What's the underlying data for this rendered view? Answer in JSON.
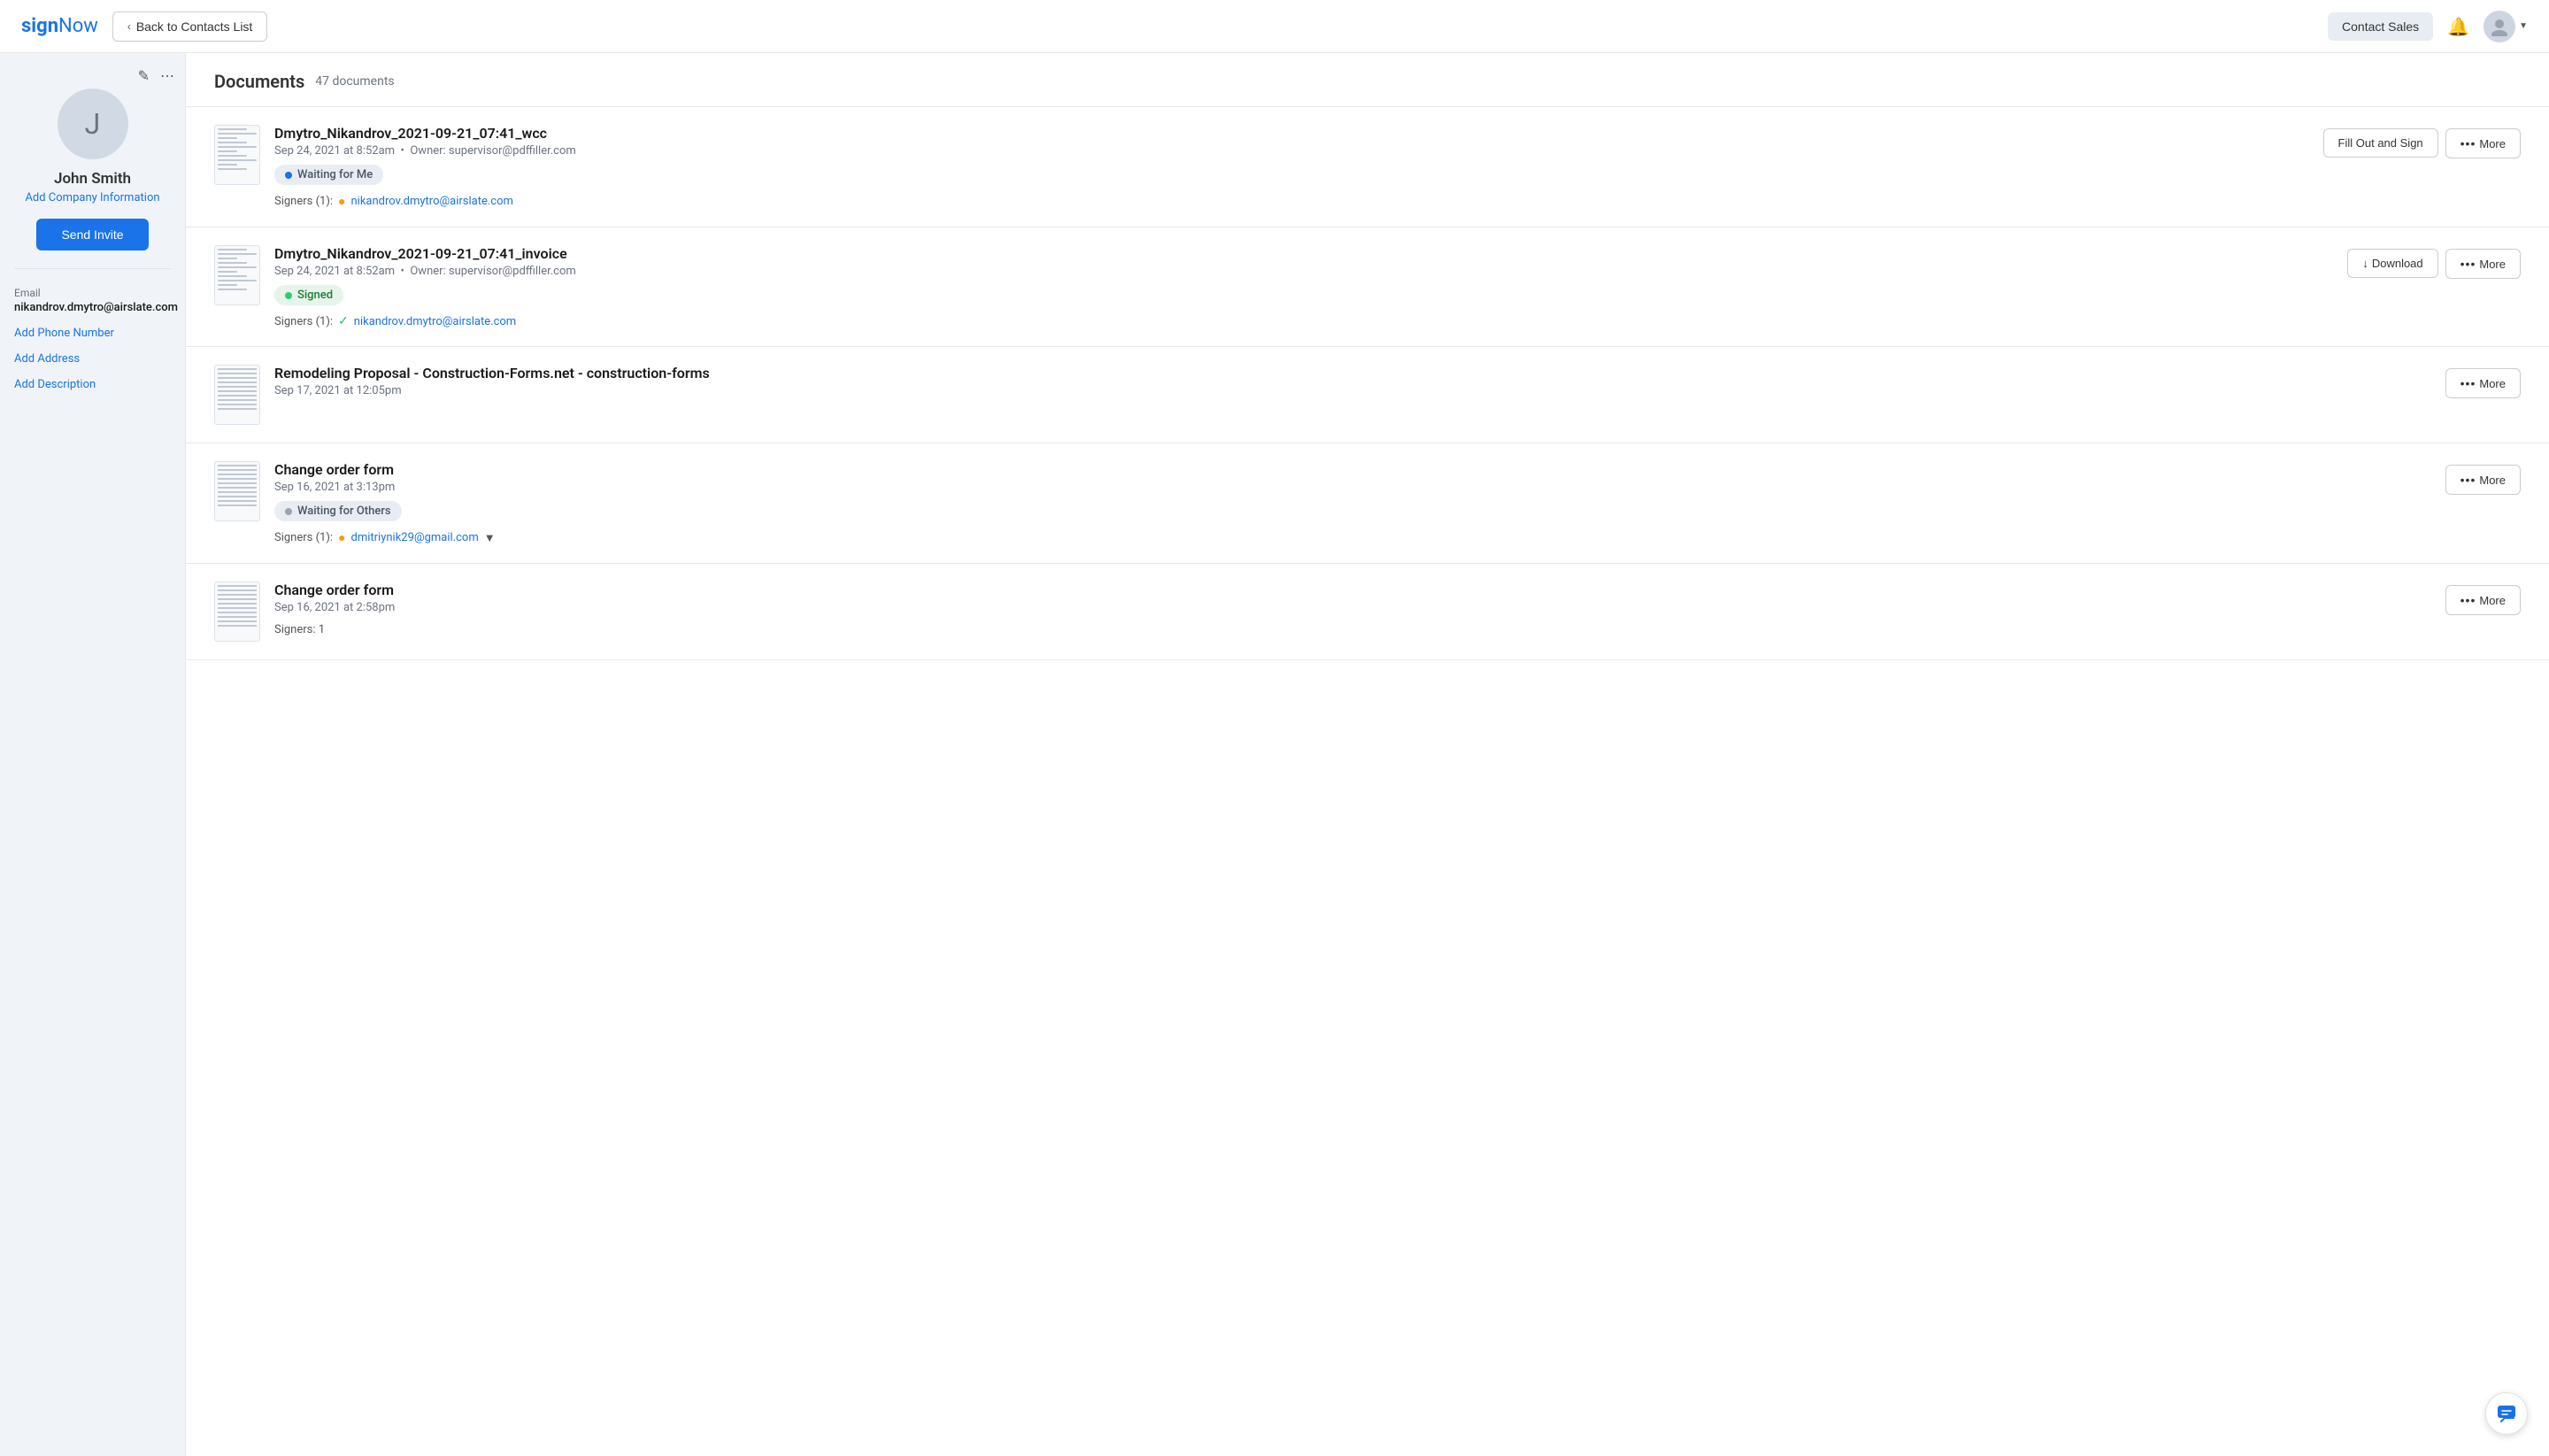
{
  "header": {
    "logo_sign": "sign",
    "logo_now": "Now",
    "back_label": "Back to Contacts List",
    "contact_sales_label": "Contact Sales"
  },
  "sidebar": {
    "contact_initial": "J",
    "contact_name": "John Smith",
    "add_company_label": "Add Company Information",
    "send_invite_label": "Send Invite",
    "email_label": "Email",
    "email_value": "nikandrov.dmytro@airslate.com",
    "add_phone_label": "Add Phone Number",
    "add_address_label": "Add Address",
    "add_description_label": "Add Description"
  },
  "documents": {
    "title": "Documents",
    "count": "47 documents",
    "items": [
      {
        "id": 1,
        "name": "Dmytro_Nikandrov_2021-09-21_07:41_wcc",
        "meta": "Sep 24, 2021 at 8:52am  •  Owner: supervisor@pdffiller.com",
        "badge": "waiting_me",
        "badge_label": "Waiting for Me",
        "signers_label": "Signers (1):",
        "signer_email": "nikandrov.dmytro@airslate.com",
        "signer_status": "orange",
        "actions": [
          "fill_sign",
          "more"
        ]
      },
      {
        "id": 2,
        "name": "Dmytro_Nikandrov_2021-09-21_07:41_invoice",
        "meta": "Sep 24, 2021 at 8:52am  •  Owner: supervisor@pdffiller.com",
        "badge": "signed",
        "badge_label": "Signed",
        "signers_label": "Signers (1):",
        "signer_email": "nikandrov.dmytro@airslate.com",
        "signer_status": "green",
        "actions": [
          "download",
          "more"
        ]
      },
      {
        "id": 3,
        "name": "Remodeling Proposal - Construction-Forms.net - construction-forms",
        "meta": "Sep 17, 2021 at 12:05pm",
        "badge": null,
        "badge_label": null,
        "signers_label": null,
        "signer_email": null,
        "signer_status": null,
        "actions": [
          "more"
        ]
      },
      {
        "id": 4,
        "name": "Change order form",
        "meta": "Sep 16, 2021 at 3:13pm",
        "badge": "waiting_others",
        "badge_label": "Waiting for Others",
        "signers_label": "Signers (1):",
        "signer_email": "dmitriynik29@gmail.com",
        "signer_status": "orange",
        "actions": [
          "more"
        ]
      },
      {
        "id": 5,
        "name": "Change order form",
        "meta": "Sep 16, 2021 at 2:58pm",
        "badge": null,
        "badge_label": null,
        "signers_label": "Signers: 1",
        "signer_email": null,
        "signer_status": null,
        "actions": [
          "more"
        ]
      }
    ]
  },
  "buttons": {
    "fill_sign_label": "Fill Out and Sign",
    "download_label": "Download",
    "more_label": "More"
  }
}
